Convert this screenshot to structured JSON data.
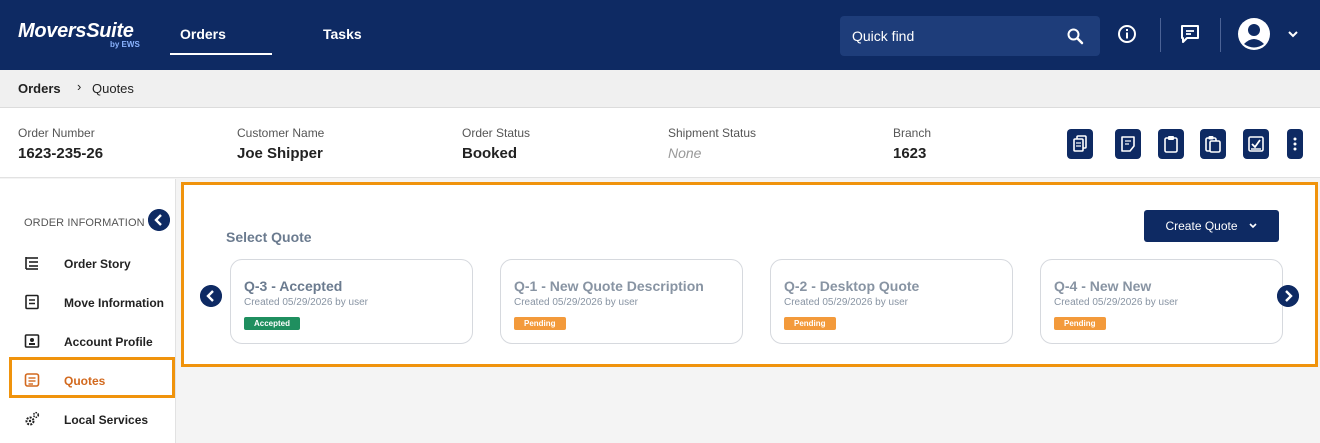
{
  "topbar": {
    "logo": "MoversSuite",
    "logo_sub": "by EWS",
    "tabs": [
      {
        "label": "Orders",
        "active": true
      },
      {
        "label": "Tasks",
        "active": false
      }
    ],
    "search_placeholder": "Quick find",
    "icons": [
      "search-icon",
      "info-icon",
      "message-icon",
      "user-avatar-icon",
      "chevron-down-icon"
    ]
  },
  "breadcrumb": {
    "root": "Orders",
    "separator": "›",
    "current": "Quotes"
  },
  "order": {
    "fields": [
      {
        "label": "Order Number",
        "value": "1623-235-26"
      },
      {
        "label": "Customer Name",
        "value": "Joe Shipper"
      },
      {
        "label": "Order Status",
        "value": "Booked"
      },
      {
        "label": "Shipment Status",
        "value": "None"
      },
      {
        "label": "Branch",
        "value": "1623"
      }
    ],
    "actions": [
      "copy-document-icon",
      "edit-note-icon",
      "clipboard-icon",
      "clipboard-copy-icon",
      "checklist-icon",
      "more-vertical-icon"
    ]
  },
  "sidebar": {
    "header": "ORDER INFORMATION",
    "items": [
      {
        "label": "Order Story",
        "icon": "list-tree-icon",
        "active": false
      },
      {
        "label": "Move Information",
        "icon": "form-icon",
        "active": false
      },
      {
        "label": "Account Profile",
        "icon": "profile-folder-icon",
        "active": false
      },
      {
        "label": "Quotes",
        "icon": "quote-list-icon",
        "active": true
      },
      {
        "label": "Local Services",
        "icon": "gears-icon",
        "active": false
      }
    ]
  },
  "quotes": {
    "title": "Select Quote",
    "create_label": "Create Quote",
    "cards": [
      {
        "title": "Q-3 - Accepted",
        "meta": "Created 05/29/2026 by user",
        "status": "Accepted"
      },
      {
        "title": "Q-1 - New Quote Description",
        "meta": "Created 05/29/2026 by user",
        "status": "Pending"
      },
      {
        "title": "Q-2 - Desktop Quote",
        "meta": "Created 05/29/2026 by user",
        "status": "Pending"
      },
      {
        "title": "Q-4 - New New",
        "meta": "Created 05/29/2026 by user",
        "status": "Pending"
      }
    ]
  },
  "colors": {
    "navy": "#0e2a63",
    "highlight": "#f0930c",
    "accepted": "#1f8f5f",
    "pending": "#f39a3b",
    "active_sidebar_text": "#d2691e"
  }
}
